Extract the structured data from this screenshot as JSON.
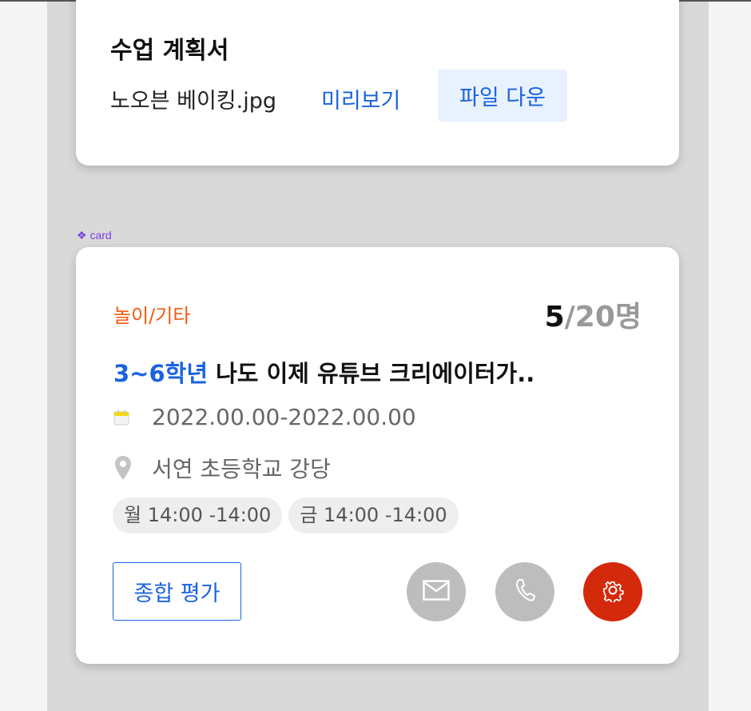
{
  "plan_card": {
    "title": "수업 계획서",
    "file_name": "노오븐 베이킹.jpg",
    "preview_label": "미리보기",
    "download_label": "파일 다운"
  },
  "component_label": "❖ card",
  "class_card": {
    "category": "놀이/기타",
    "enrolled": "5",
    "capacity": "/20명",
    "grade": "3~6학년",
    "title": " 나도 이제 유튜브 크리에이터가..",
    "date_range": "2022.00.00-2022.00.00",
    "location": "서연 초등학교 강당",
    "schedule": [
      {
        "label": "월 14:00 -14:00"
      },
      {
        "label": "금 14:00 -14:00"
      }
    ],
    "evaluation_label": "종합 평가",
    "actions": [
      {
        "icon": "mail-icon",
        "color": "#bdbdbd"
      },
      {
        "icon": "phone-icon",
        "color": "#bdbdbd"
      },
      {
        "icon": "gear-icon",
        "color": "#d42a0c"
      }
    ]
  }
}
